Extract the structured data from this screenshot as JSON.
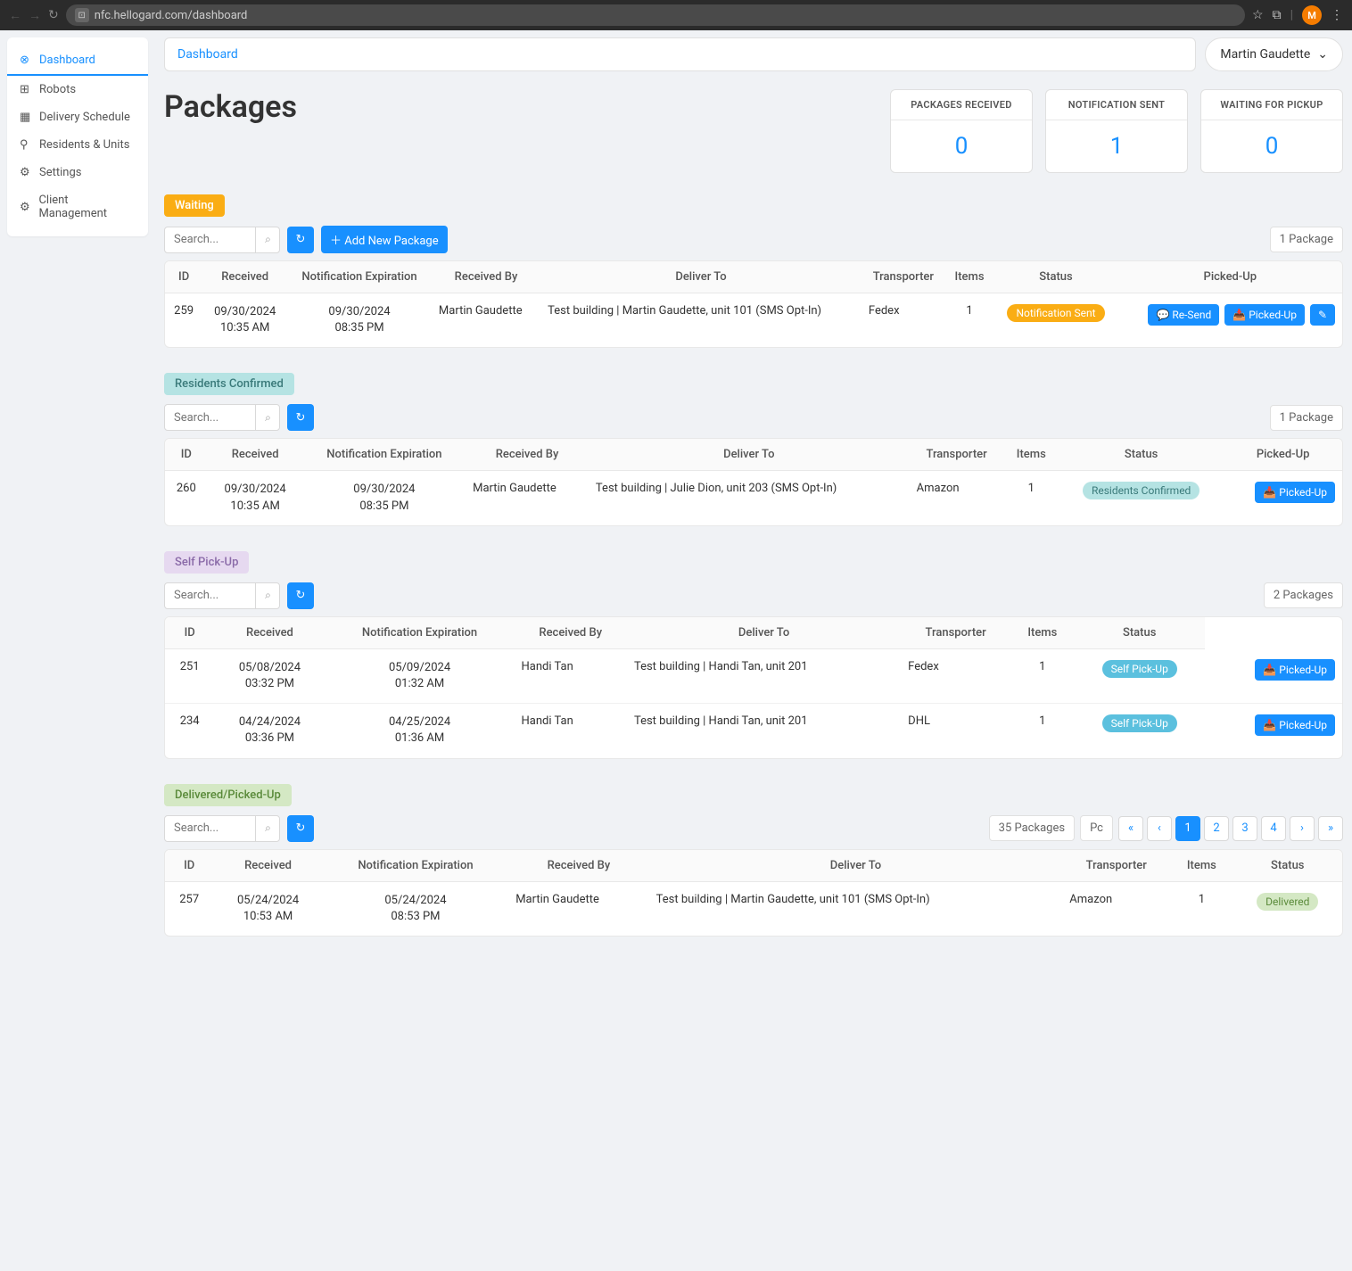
{
  "browser": {
    "url": "nfc.hellogard.com/dashboard",
    "avatar_letter": "M"
  },
  "sidebar": {
    "items": [
      {
        "icon": "⊗",
        "label": "Dashboard",
        "active": true
      },
      {
        "icon": "⊞",
        "label": "Robots"
      },
      {
        "icon": "▦",
        "label": "Delivery Schedule"
      },
      {
        "icon": "⚲",
        "label": "Residents & Units"
      },
      {
        "icon": "⚙",
        "label": "Settings"
      },
      {
        "icon": "⚙",
        "label": "Client Management"
      }
    ]
  },
  "breadcrumb": "Dashboard",
  "user_name": "Martin Gaudette",
  "page_title": "Packages",
  "stats": [
    {
      "label": "PACKAGES RECEIVED",
      "value": "0"
    },
    {
      "label": "NOTIFICATION SENT",
      "value": "1"
    },
    {
      "label": "WAITING FOR PICKUP",
      "value": "0"
    }
  ],
  "search_placeholder": "Search...",
  "refresh_icon": "↻",
  "add_package_label": "Add New Package",
  "columns": {
    "id": "ID",
    "received": "Received",
    "expiration": "Notification Expiration",
    "received_by": "Received By",
    "deliver_to": "Deliver To",
    "transporter": "Transporter",
    "items": "Items",
    "status": "Status",
    "picked_up": "Picked-Up"
  },
  "actions": {
    "resend": "Re-Send",
    "pickedup": "Picked-Up",
    "edit": "✎"
  },
  "sections": {
    "waiting": {
      "title": "Waiting",
      "count": "1 Package",
      "rows": [
        {
          "id": "259",
          "received_l1": "09/30/2024",
          "received_l2": "10:35 AM",
          "exp_l1": "09/30/2024",
          "exp_l2": "08:35 PM",
          "received_by": "Martin Gaudette",
          "deliver_to": "Test building | Martin Gaudette, unit 101 (SMS Opt-In)",
          "transporter": "Fedex",
          "items": "1",
          "status": "Notification Sent"
        }
      ]
    },
    "confirmed": {
      "title": "Residents Confirmed",
      "count": "1 Package",
      "rows": [
        {
          "id": "260",
          "received_l1": "09/30/2024",
          "received_l2": "10:35 AM",
          "exp_l1": "09/30/2024",
          "exp_l2": "08:35 PM",
          "received_by": "Martin Gaudette",
          "deliver_to": "Test building | Julie Dion, unit 203 (SMS Opt-In)",
          "transporter": "Amazon",
          "items": "1",
          "status": "Residents Confirmed"
        }
      ]
    },
    "selfpickup": {
      "title": "Self Pick-Up",
      "count": "2 Packages",
      "rows": [
        {
          "id": "251",
          "received_l1": "05/08/2024",
          "received_l2": "03:32 PM",
          "exp_l1": "05/09/2024",
          "exp_l2": "01:32 AM",
          "received_by": "Handi Tan",
          "deliver_to": "Test building | Handi Tan, unit 201",
          "transporter": "Fedex",
          "items": "1",
          "status": "Self Pick-Up"
        },
        {
          "id": "234",
          "received_l1": "04/24/2024",
          "received_l2": "03:36 PM",
          "exp_l1": "04/25/2024",
          "exp_l2": "01:36 AM",
          "received_by": "Handi Tan",
          "deliver_to": "Test building | Handi Tan, unit 201",
          "transporter": "DHL",
          "items": "1",
          "status": "Self Pick-Up"
        }
      ]
    },
    "delivered": {
      "title": "Delivered/Picked-Up",
      "count": "35 Packages",
      "pc_label": "Pc",
      "pages": [
        "«",
        "‹",
        "1",
        "2",
        "3",
        "4",
        "›",
        "»"
      ],
      "active_page": "1",
      "rows": [
        {
          "id": "257",
          "received_l1": "05/24/2024",
          "received_l2": "10:53 AM",
          "exp_l1": "05/24/2024",
          "exp_l2": "08:53 PM",
          "received_by": "Martin Gaudette",
          "deliver_to": "Test building | Martin Gaudette, unit 101 (SMS Opt-In)",
          "transporter": "Amazon",
          "items": "1",
          "status": "Delivered"
        }
      ]
    }
  }
}
